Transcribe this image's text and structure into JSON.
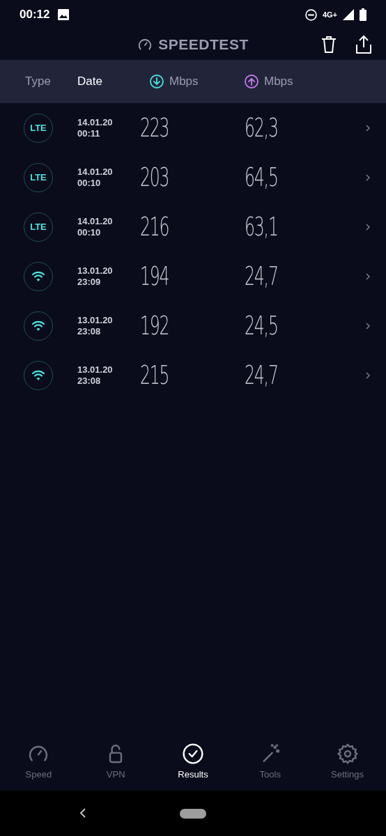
{
  "status_bar": {
    "time": "00:12",
    "network": "4G+"
  },
  "header": {
    "title": "SPEEDTEST"
  },
  "columns": [
    {
      "kind": "text",
      "label": "Type",
      "selected": false
    },
    {
      "kind": "text",
      "label": "Date",
      "selected": true
    },
    {
      "kind": "download",
      "label": "Mbps",
      "selected": false
    },
    {
      "kind": "upload",
      "label": "Mbps",
      "selected": false
    }
  ],
  "rows": [
    {
      "kind": "lte",
      "badge": "LTE",
      "date": "14.01.20",
      "time": "00:11",
      "download": "223",
      "upload": "62,3"
    },
    {
      "kind": "lte",
      "badge": "LTE",
      "date": "14.01.20",
      "time": "00:10",
      "download": "203",
      "upload": "64,5"
    },
    {
      "kind": "lte",
      "badge": "LTE",
      "date": "14.01.20",
      "time": "00:10",
      "download": "216",
      "upload": "63,1"
    },
    {
      "kind": "wifi",
      "date": "13.01.20",
      "time": "23:09",
      "download": "194",
      "upload": "24,7"
    },
    {
      "kind": "wifi",
      "date": "13.01.20",
      "time": "23:08",
      "download": "192",
      "upload": "24,5"
    },
    {
      "kind": "wifi",
      "date": "13.01.20",
      "time": "23:08",
      "download": "215",
      "upload": "24,7"
    }
  ],
  "nav": [
    {
      "kind": "speed",
      "label": "Speed",
      "selected": false
    },
    {
      "kind": "vpn",
      "label": "VPN",
      "selected": false
    },
    {
      "kind": "results",
      "label": "Results",
      "selected": true
    },
    {
      "kind": "tools",
      "label": "Tools",
      "selected": false
    },
    {
      "kind": "settings",
      "label": "Settings",
      "selected": false
    }
  ]
}
